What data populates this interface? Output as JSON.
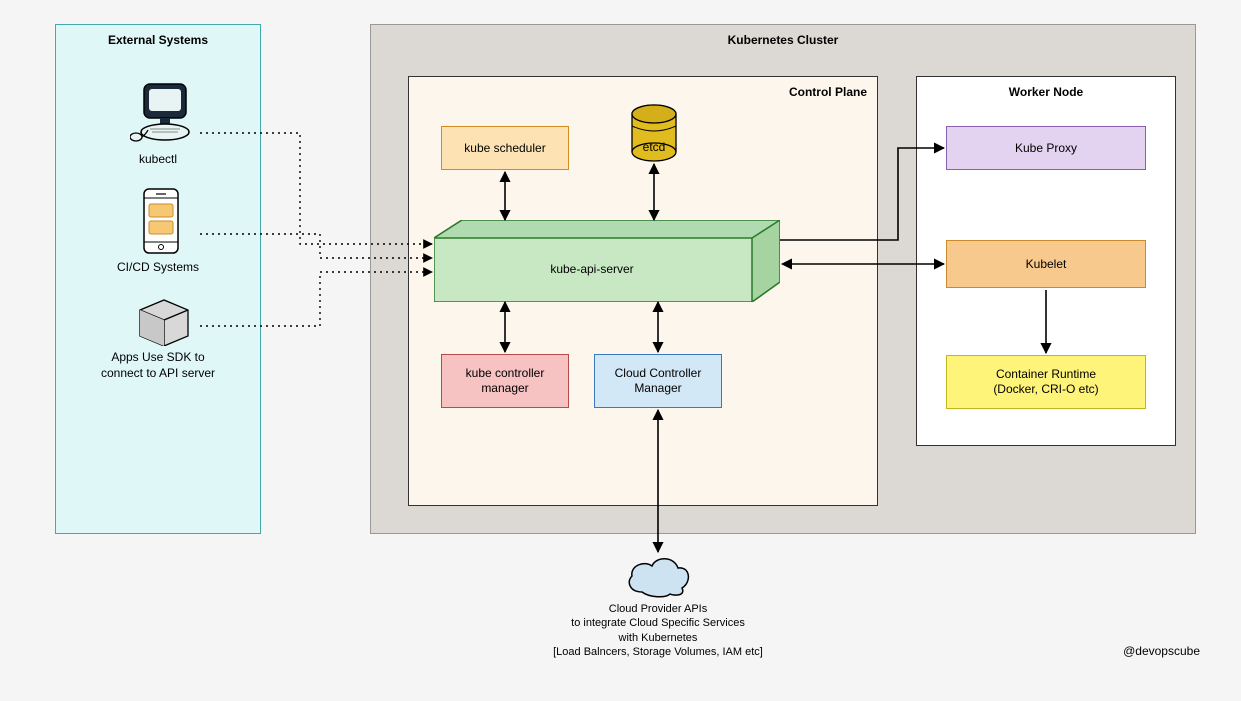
{
  "external": {
    "title": "External Systems",
    "kubectl": "kubectl",
    "cicd": "CI/CD Systems",
    "apps": "Apps Use SDK to\nconnect to API server"
  },
  "cluster": {
    "title": "Kubernetes Cluster",
    "controlPlane": {
      "title": "Control Plane",
      "scheduler": "kube scheduler",
      "etcd": "etcd",
      "apiServer": "kube-api-server",
      "kubeControllerMgr": "kube controller\nmanager",
      "cloudControllerMgr": "Cloud Controller\nManager"
    },
    "workerNode": {
      "title": "Worker Node",
      "kubeProxy": "Kube Proxy",
      "kubelet": "Kubelet",
      "runtime": "Container Runtime\n(Docker, CRI-O etc)"
    }
  },
  "cloud": {
    "text": "Cloud Provider APIs\nto integrate Cloud Specific Services\nwith Kubernetes\n[Load Balncers, Storage Volumes, IAM etc]"
  },
  "watermark": "@devopscube"
}
